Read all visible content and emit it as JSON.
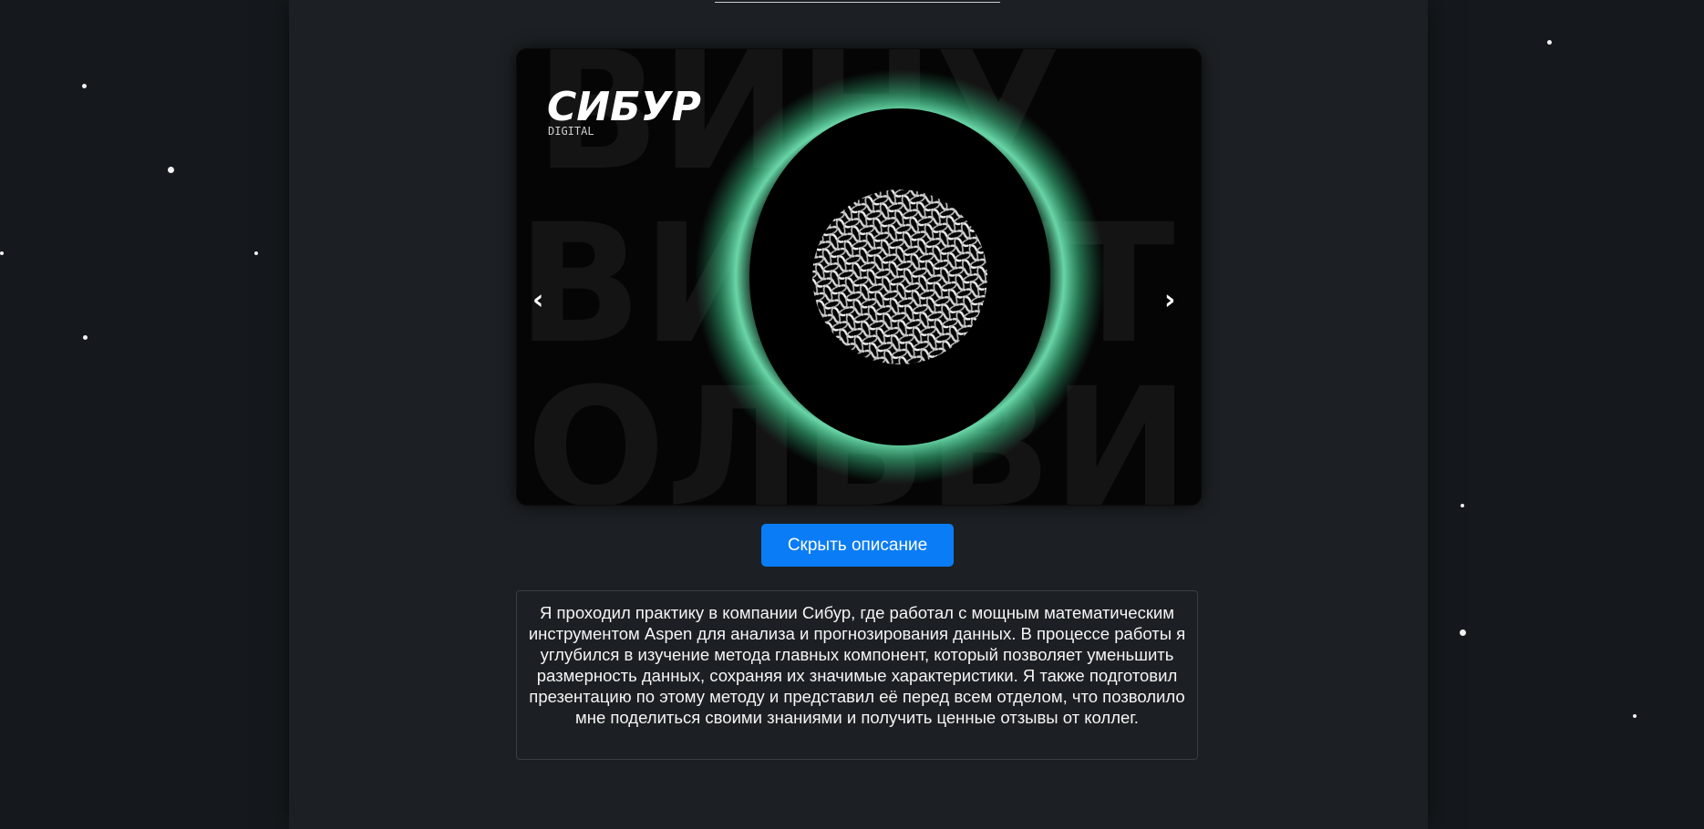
{
  "slider": {
    "image": {
      "logo_text": "СИБУР",
      "logo_subtext": "DIGITAL",
      "background_letters_row1": "ВИНУ",
      "background_letters_row2": "ВИДИТ",
      "background_letters_row3": "ОЛЬВИ",
      "glow_color": "#3ec98a"
    },
    "prev_label": "‹",
    "next_label": "›"
  },
  "toggle_button": {
    "label": "Скрыть описание",
    "color": "#0a7cf6"
  },
  "description": {
    "text": "Я проходил практику в компании Сибур, где работал с мощным математическим инструментом Aspen для анализа и прогнозирования данных. В процессе работы я углубился в изучение метода главных компонент, который позволяет уменьшить размерность данных, сохраняя их значимые характеристики. Я также подготовил презентацию по этому методу и представил её перед всем отделом, что позволило мне поделиться своими знаниями и получить ценные отзывы от коллег."
  },
  "colors": {
    "page_background": "#15191d",
    "column_background": "#1c2024",
    "accent": "#0a7cf6"
  }
}
